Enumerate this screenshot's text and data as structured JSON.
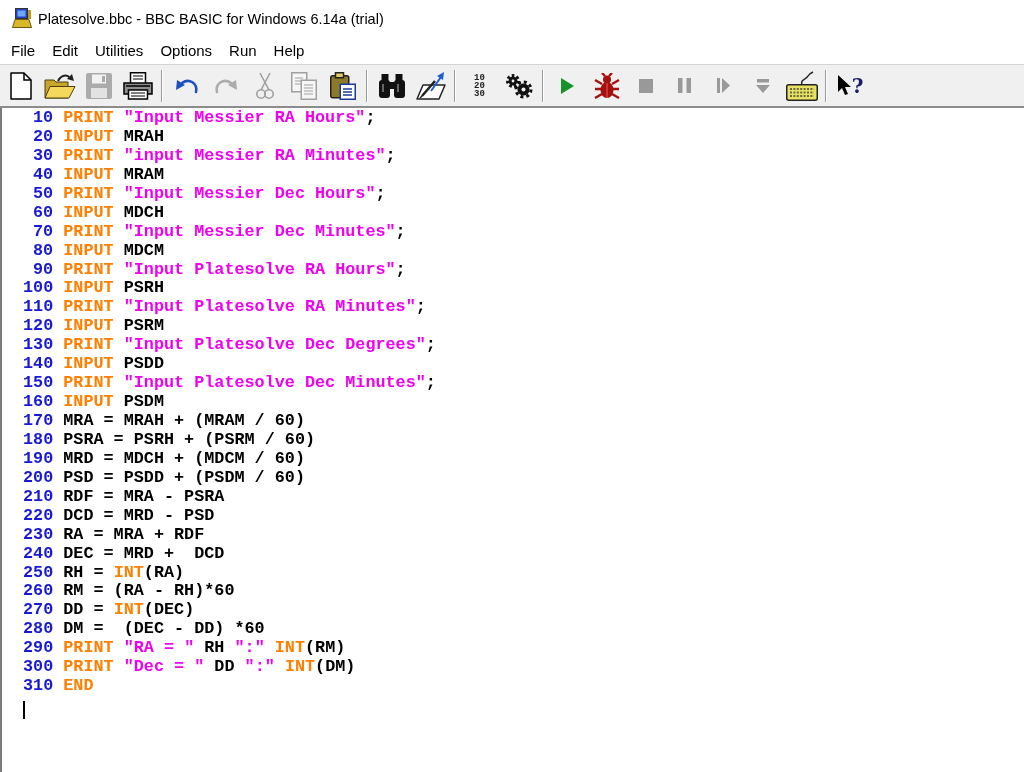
{
  "window": {
    "title": "Platesolve.bbc - BBC BASIC for Windows 6.14a (trial)"
  },
  "menu": [
    "File",
    "Edit",
    "Utilities",
    "Options",
    "Run",
    "Help"
  ],
  "toolbar": {
    "groups": [
      {
        "buttons": [
          {
            "kind": "new",
            "disabled": false
          },
          {
            "kind": "open",
            "disabled": false
          },
          {
            "kind": "save",
            "disabled": true
          },
          {
            "kind": "print",
            "disabled": false
          }
        ]
      },
      {
        "buttons": [
          {
            "kind": "undo",
            "disabled": false
          },
          {
            "kind": "redo",
            "disabled": true
          },
          {
            "kind": "cut",
            "disabled": true
          },
          {
            "kind": "copy",
            "disabled": true
          },
          {
            "kind": "paste",
            "disabled": false
          }
        ]
      },
      {
        "buttons": [
          {
            "kind": "find",
            "disabled": false
          },
          {
            "kind": "replace",
            "disabled": false
          }
        ]
      },
      {
        "buttons": [
          {
            "kind": "renumber",
            "disabled": false,
            "lines": [
              "10",
              "20",
              "30"
            ]
          },
          {
            "kind": "compile",
            "disabled": false
          }
        ]
      },
      {
        "buttons": [
          {
            "kind": "run",
            "disabled": false
          },
          {
            "kind": "debug",
            "disabled": false
          },
          {
            "kind": "stop",
            "disabled": true
          },
          {
            "kind": "pause",
            "disabled": true
          },
          {
            "kind": "step",
            "disabled": true
          },
          {
            "kind": "trace",
            "disabled": true
          },
          {
            "kind": "immediate",
            "disabled": false
          }
        ]
      },
      {
        "buttons": [
          {
            "kind": "help",
            "disabled": false,
            "text": "?"
          }
        ]
      }
    ]
  },
  "editor": {
    "lines": [
      {
        "number": "10",
        "tokens": [
          {
            "kind": "keyword",
            "text": "PRINT "
          },
          {
            "kind": "string",
            "text": "\"Input Messier RA Hours\""
          },
          {
            "kind": "plain",
            "text": ";"
          }
        ]
      },
      {
        "number": "20",
        "tokens": [
          {
            "kind": "keyword",
            "text": "INPUT "
          },
          {
            "kind": "plain",
            "text": "MRAH"
          }
        ]
      },
      {
        "number": "30",
        "tokens": [
          {
            "kind": "keyword",
            "text": "PRINT "
          },
          {
            "kind": "string",
            "text": "\"input Messier RA Minutes\""
          },
          {
            "kind": "plain",
            "text": ";"
          }
        ]
      },
      {
        "number": "40",
        "tokens": [
          {
            "kind": "keyword",
            "text": "INPUT "
          },
          {
            "kind": "plain",
            "text": "MRAM"
          }
        ]
      },
      {
        "number": "50",
        "tokens": [
          {
            "kind": "keyword",
            "text": "PRINT "
          },
          {
            "kind": "string",
            "text": "\"Input Messier Dec Hours\""
          },
          {
            "kind": "plain",
            "text": ";"
          }
        ]
      },
      {
        "number": "60",
        "tokens": [
          {
            "kind": "keyword",
            "text": "INPUT "
          },
          {
            "kind": "plain",
            "text": "MDCH"
          }
        ]
      },
      {
        "number": "70",
        "tokens": [
          {
            "kind": "keyword",
            "text": "PRINT "
          },
          {
            "kind": "string",
            "text": "\"Input Messier Dec Minutes\""
          },
          {
            "kind": "plain",
            "text": ";"
          }
        ]
      },
      {
        "number": "80",
        "tokens": [
          {
            "kind": "keyword",
            "text": "INPUT "
          },
          {
            "kind": "plain",
            "text": "MDCM"
          }
        ]
      },
      {
        "number": "90",
        "tokens": [
          {
            "kind": "keyword",
            "text": "PRINT "
          },
          {
            "kind": "string",
            "text": "\"Input Platesolve RA Hours\""
          },
          {
            "kind": "plain",
            "text": ";"
          }
        ]
      },
      {
        "number": "100",
        "tokens": [
          {
            "kind": "keyword",
            "text": "INPUT "
          },
          {
            "kind": "plain",
            "text": "PSRH"
          }
        ]
      },
      {
        "number": "110",
        "tokens": [
          {
            "kind": "keyword",
            "text": "PRINT "
          },
          {
            "kind": "string",
            "text": "\"Input Platesolve RA Minutes\""
          },
          {
            "kind": "plain",
            "text": ";"
          }
        ]
      },
      {
        "number": "120",
        "tokens": [
          {
            "kind": "keyword",
            "text": "INPUT "
          },
          {
            "kind": "plain",
            "text": "PSRM"
          }
        ]
      },
      {
        "number": "130",
        "tokens": [
          {
            "kind": "keyword",
            "text": "PRINT "
          },
          {
            "kind": "string",
            "text": "\"Input Platesolve Dec Degrees\""
          },
          {
            "kind": "plain",
            "text": ";"
          }
        ]
      },
      {
        "number": "140",
        "tokens": [
          {
            "kind": "keyword",
            "text": "INPUT "
          },
          {
            "kind": "plain",
            "text": "PSDD"
          }
        ]
      },
      {
        "number": "150",
        "tokens": [
          {
            "kind": "keyword",
            "text": "PRINT "
          },
          {
            "kind": "string",
            "text": "\"Input Platesolve Dec Minutes\""
          },
          {
            "kind": "plain",
            "text": ";"
          }
        ]
      },
      {
        "number": "160",
        "tokens": [
          {
            "kind": "keyword",
            "text": "INPUT "
          },
          {
            "kind": "plain",
            "text": "PSDM"
          }
        ]
      },
      {
        "number": "170",
        "tokens": [
          {
            "kind": "plain",
            "text": "MRA = MRAH + (MRAM / 60)"
          }
        ]
      },
      {
        "number": "180",
        "tokens": [
          {
            "kind": "plain",
            "text": "PSRA = PSRH + (PSRM / 60)"
          }
        ]
      },
      {
        "number": "190",
        "tokens": [
          {
            "kind": "plain",
            "text": "MRD = MDCH + (MDCM / 60)"
          }
        ]
      },
      {
        "number": "200",
        "tokens": [
          {
            "kind": "plain",
            "text": "PSD = PSDD + (PSDM / 60)"
          }
        ]
      },
      {
        "number": "210",
        "tokens": [
          {
            "kind": "plain",
            "text": "RDF = MRA - PSRA"
          }
        ]
      },
      {
        "number": "220",
        "tokens": [
          {
            "kind": "plain",
            "text": "DCD = MRD - PSD"
          }
        ]
      },
      {
        "number": "230",
        "tokens": [
          {
            "kind": "plain",
            "text": "RA = MRA + RDF"
          }
        ]
      },
      {
        "number": "240",
        "tokens": [
          {
            "kind": "plain",
            "text": "DEC = MRD +  DCD"
          }
        ]
      },
      {
        "number": "250",
        "tokens": [
          {
            "kind": "plain",
            "text": "RH = "
          },
          {
            "kind": "keyword",
            "text": "INT"
          },
          {
            "kind": "plain",
            "text": "(RA)"
          }
        ]
      },
      {
        "number": "260",
        "tokens": [
          {
            "kind": "plain",
            "text": "RM = (RA - RH)*60"
          }
        ]
      },
      {
        "number": "270",
        "tokens": [
          {
            "kind": "plain",
            "text": "DD = "
          },
          {
            "kind": "keyword",
            "text": "INT"
          },
          {
            "kind": "plain",
            "text": "(DEC)"
          }
        ]
      },
      {
        "number": "280",
        "tokens": [
          {
            "kind": "plain",
            "text": "DM =  (DEC - DD) *60"
          }
        ]
      },
      {
        "number": "290",
        "tokens": [
          {
            "kind": "keyword",
            "text": "PRINT "
          },
          {
            "kind": "string",
            "text": "\"RA = \""
          },
          {
            "kind": "plain",
            "text": " RH "
          },
          {
            "kind": "string",
            "text": "\":\" "
          },
          {
            "kind": "keyword",
            "text": "INT"
          },
          {
            "kind": "plain",
            "text": "(RM)"
          }
        ]
      },
      {
        "number": "300",
        "tokens": [
          {
            "kind": "keyword",
            "text": "PRINT "
          },
          {
            "kind": "string",
            "text": "\"Dec = \""
          },
          {
            "kind": "plain",
            "text": " DD "
          },
          {
            "kind": "string",
            "text": "\":\" "
          },
          {
            "kind": "keyword",
            "text": "INT"
          },
          {
            "kind": "plain",
            "text": "(DM)"
          }
        ]
      },
      {
        "number": "310",
        "tokens": [
          {
            "kind": "keyword",
            "text": "END"
          }
        ]
      }
    ]
  }
}
